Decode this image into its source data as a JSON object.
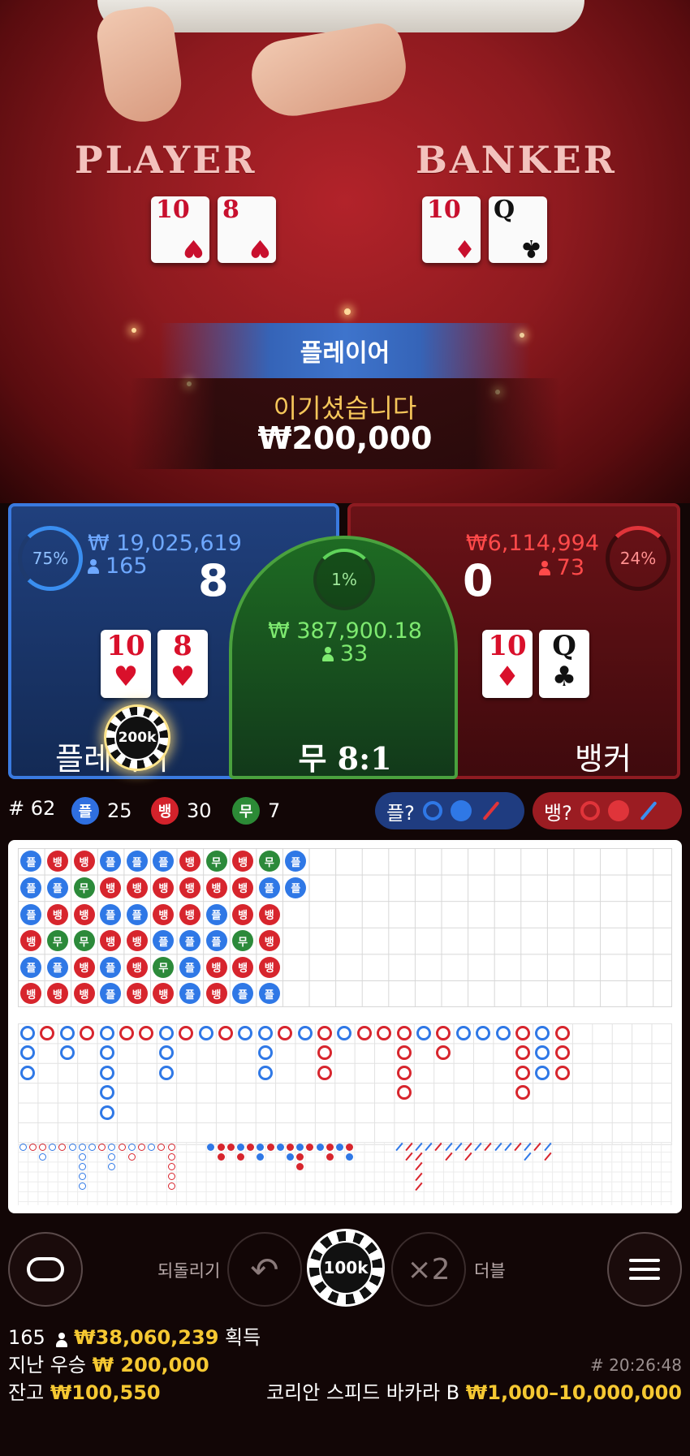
{
  "table": {
    "player_title": "PLAYER",
    "banker_title": "BANKER",
    "player_cards": [
      {
        "rank": "10",
        "suit": "♥",
        "color": "red"
      },
      {
        "rank": "8",
        "suit": "♥",
        "color": "red"
      }
    ],
    "banker_cards": [
      {
        "rank": "10",
        "suit": "♦",
        "color": "red"
      },
      {
        "rank": "Q",
        "suit": "♣",
        "color": "black"
      }
    ]
  },
  "result": {
    "winner": "플레이어",
    "message": "이기셨습니다",
    "amount": "₩200,000"
  },
  "player": {
    "percent": "75%",
    "total": "₩ 19,025,619",
    "bettors": "165",
    "score": "8",
    "label": "플레이어",
    "card1_rank": "10",
    "card1_suit": "♥",
    "card2_rank": "8",
    "card2_suit": "♥",
    "chip": "200k"
  },
  "tie": {
    "percent": "1%",
    "total": "₩ 387,900.18",
    "bettors": "33",
    "label": "무 8:1"
  },
  "banker": {
    "percent": "24%",
    "total": "₩6,114,994",
    "bettors": "73",
    "score": "0",
    "label": "뱅커",
    "card1_rank": "10",
    "card1_suit": "♦",
    "card2_rank": "Q",
    "card2_suit": "♣"
  },
  "stats": {
    "round": "# 62",
    "player_badge": "플",
    "player_count": "25",
    "banker_badge": "뱅",
    "banker_count": "30",
    "tie_badge": "무",
    "tie_count": "7",
    "player_predict": "플?",
    "banker_predict": "뱅?"
  },
  "bead_road": {
    "columns": [
      [
        "P",
        "P",
        "P",
        "B",
        "P",
        "B"
      ],
      [
        "B",
        "P",
        "B",
        "T",
        "P",
        "B"
      ],
      [
        "B",
        "T",
        "B",
        "T",
        "B",
        "B"
      ],
      [
        "P",
        "B",
        "P",
        "B",
        "P",
        "P"
      ],
      [
        "P",
        "B",
        "P",
        "B",
        "B",
        "B"
      ],
      [
        "P",
        "B",
        "B",
        "P",
        "T",
        "B"
      ],
      [
        "B",
        "B",
        "B",
        "P",
        "P",
        "P"
      ],
      [
        "T",
        "B",
        "P",
        "P",
        "B",
        "B"
      ],
      [
        "B",
        "B",
        "B",
        "T",
        "B",
        "P"
      ],
      [
        "T",
        "P",
        "B",
        "B",
        "B",
        "P"
      ],
      [
        "P",
        "P"
      ]
    ]
  },
  "controls": {
    "undo_label": "되돌리기",
    "chip_value": "100k",
    "double_symbol": "×2",
    "double_label": "더블"
  },
  "footer": {
    "players": "165",
    "total_won": "₩38,060,239",
    "won_suffix": "획득",
    "last_win_label": "지난 우승",
    "last_win": "₩ 200,000",
    "balance_label": "잔고",
    "balance": "₩100,550",
    "game_id": "# 20:26:48",
    "table_name": "코리안 스피드 바카라 B",
    "limits": "₩1,000–10,000,000"
  },
  "colors": {
    "player": "#2f78e6",
    "banker": "#d7252d",
    "tie": "#2c8a3a",
    "gold": "#f5c832"
  }
}
